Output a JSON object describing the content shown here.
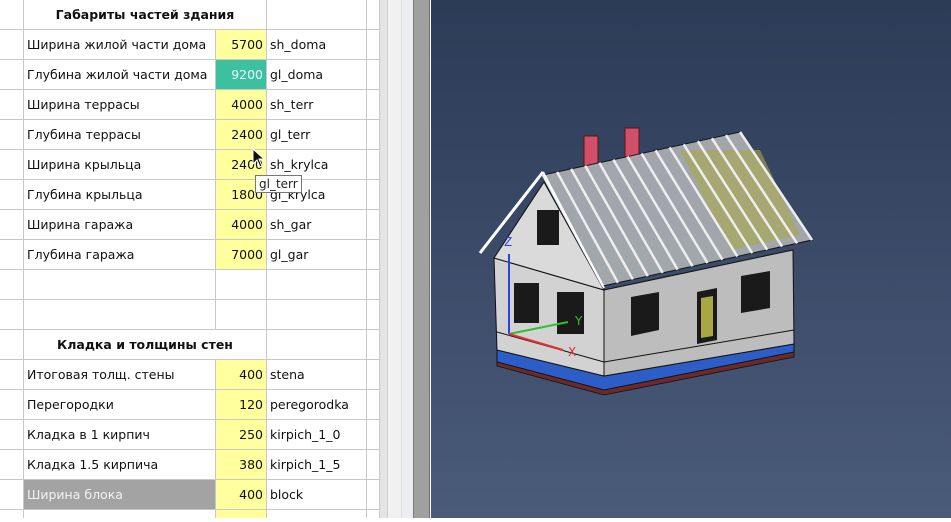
{
  "sheet": {
    "rows": [
      {
        "type": "header",
        "label": "Габариты частей здания"
      },
      {
        "type": "param",
        "label": "Ширина жилой части дома",
        "value": "5700",
        "alias": "sh_doma"
      },
      {
        "type": "param",
        "label": "Глубина жилой части дома",
        "value": "9200",
        "alias": "gl_doma",
        "style": "teal"
      },
      {
        "type": "param",
        "label": "Ширина террасы",
        "value": "4000",
        "alias": "sh_terr"
      },
      {
        "type": "param",
        "label": "Глубина террасы",
        "value": "2400",
        "alias": "gl_terr"
      },
      {
        "type": "param",
        "label": "Ширина крыльца",
        "value": "2400",
        "alias": "sh_krylca"
      },
      {
        "type": "param",
        "label": "Глубина крыльца",
        "value": "1800",
        "alias": "gl_krylca"
      },
      {
        "type": "param",
        "label": "Ширина гаража",
        "value": "4000",
        "alias": "sh_gar"
      },
      {
        "type": "param",
        "label": "Глубина гаража",
        "value": "7000",
        "alias": "gl_gar"
      },
      {
        "type": "empty"
      },
      {
        "type": "empty"
      },
      {
        "type": "header",
        "label": "Кладка и толщины стен"
      },
      {
        "type": "param",
        "label": "Итоговая толщ. стены",
        "value": "400",
        "alias": "stena"
      },
      {
        "type": "param",
        "label": "Перегородки",
        "value": "120",
        "alias": "peregorodka"
      },
      {
        "type": "param",
        "label": "Кладка в 1 кирпич",
        "value": "250",
        "alias": "kirpich_1_0"
      },
      {
        "type": "param",
        "label": "Кладка 1.5 кирпича",
        "value": "380",
        "alias": "kirpich_1_5"
      },
      {
        "type": "param",
        "label": "Ширина блока",
        "value": "400",
        "alias": "block",
        "labelStyle": "grey"
      },
      {
        "type": "partial"
      }
    ]
  },
  "tooltip": "gl_terr",
  "viewport": {
    "axes": {
      "x": "X",
      "y": "Y",
      "z": "Z"
    },
    "colors": {
      "x": "#e03030",
      "y": "#30c030",
      "z": "#3040e0"
    }
  }
}
